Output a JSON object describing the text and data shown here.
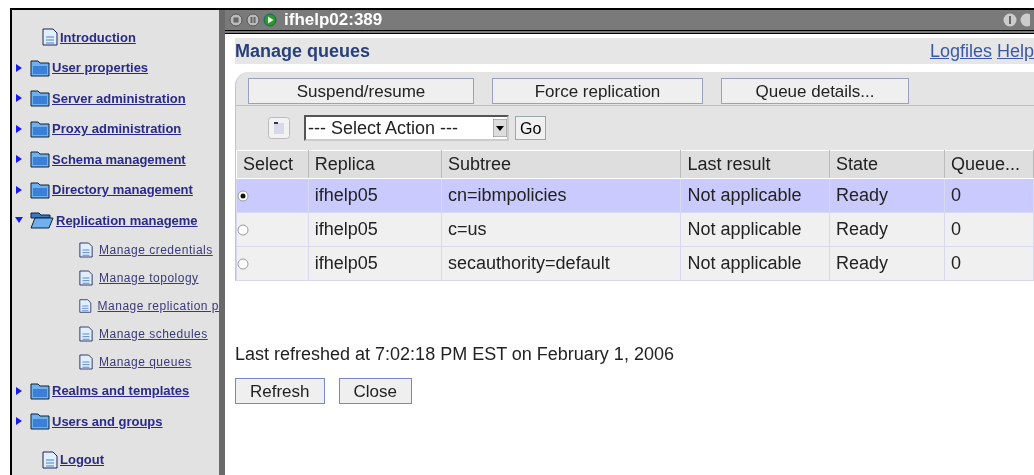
{
  "sidebar": {
    "items": [
      {
        "kind": "page",
        "label": "Introduction"
      },
      {
        "kind": "folder",
        "label": "User properties",
        "expanded": false
      },
      {
        "kind": "folder",
        "label": "Server administration",
        "expanded": false
      },
      {
        "kind": "folder",
        "label": "Proxy administration",
        "expanded": false
      },
      {
        "kind": "folder",
        "label": "Schema management",
        "expanded": false
      },
      {
        "kind": "folder",
        "label": "Directory management",
        "expanded": false
      },
      {
        "kind": "folder",
        "label": "Replication manageme",
        "expanded": true,
        "children": [
          {
            "kind": "page",
            "label": "Manage credentials"
          },
          {
            "kind": "page",
            "label": "Manage topology"
          },
          {
            "kind": "page",
            "label": "Manage replication p"
          },
          {
            "kind": "page",
            "label": "Manage schedules"
          },
          {
            "kind": "page",
            "label": "Manage queues"
          }
        ]
      },
      {
        "kind": "folder",
        "label": "Realms and templates",
        "expanded": false
      },
      {
        "kind": "folder",
        "label": "Users and groups",
        "expanded": false
      },
      {
        "kind": "page",
        "label": "Logout"
      }
    ]
  },
  "window": {
    "title": "ifhelp02:389"
  },
  "page_title": "Manage queues",
  "header_links": [
    "Logfiles",
    "Help"
  ],
  "toolbar_buttons": [
    "Suspend/resume",
    "Force replication",
    "Queue details..."
  ],
  "action_select": {
    "value": "--- Select Action ---"
  },
  "go_button": "Go",
  "table": {
    "columns": [
      "Select",
      "Replica",
      "Subtree",
      "Last result",
      "State",
      "Queue..."
    ],
    "rows": [
      {
        "selected": true,
        "cells": [
          "",
          "ifhelp05",
          "cn=ibmpolicies",
          "Not applicable",
          "Ready",
          "0"
        ]
      },
      {
        "selected": false,
        "cells": [
          "",
          "ifhelp05",
          "c=us",
          "Not applicable",
          "Ready",
          "0"
        ]
      },
      {
        "selected": false,
        "cells": [
          "",
          "ifhelp05",
          "secauthority=default",
          "Not applicable",
          "Ready",
          "0"
        ]
      }
    ]
  },
  "last_refreshed": "Last refreshed at 7:02:18 PM EST on February 1, 2006",
  "bottom_buttons": [
    "Refresh",
    "Close"
  ]
}
